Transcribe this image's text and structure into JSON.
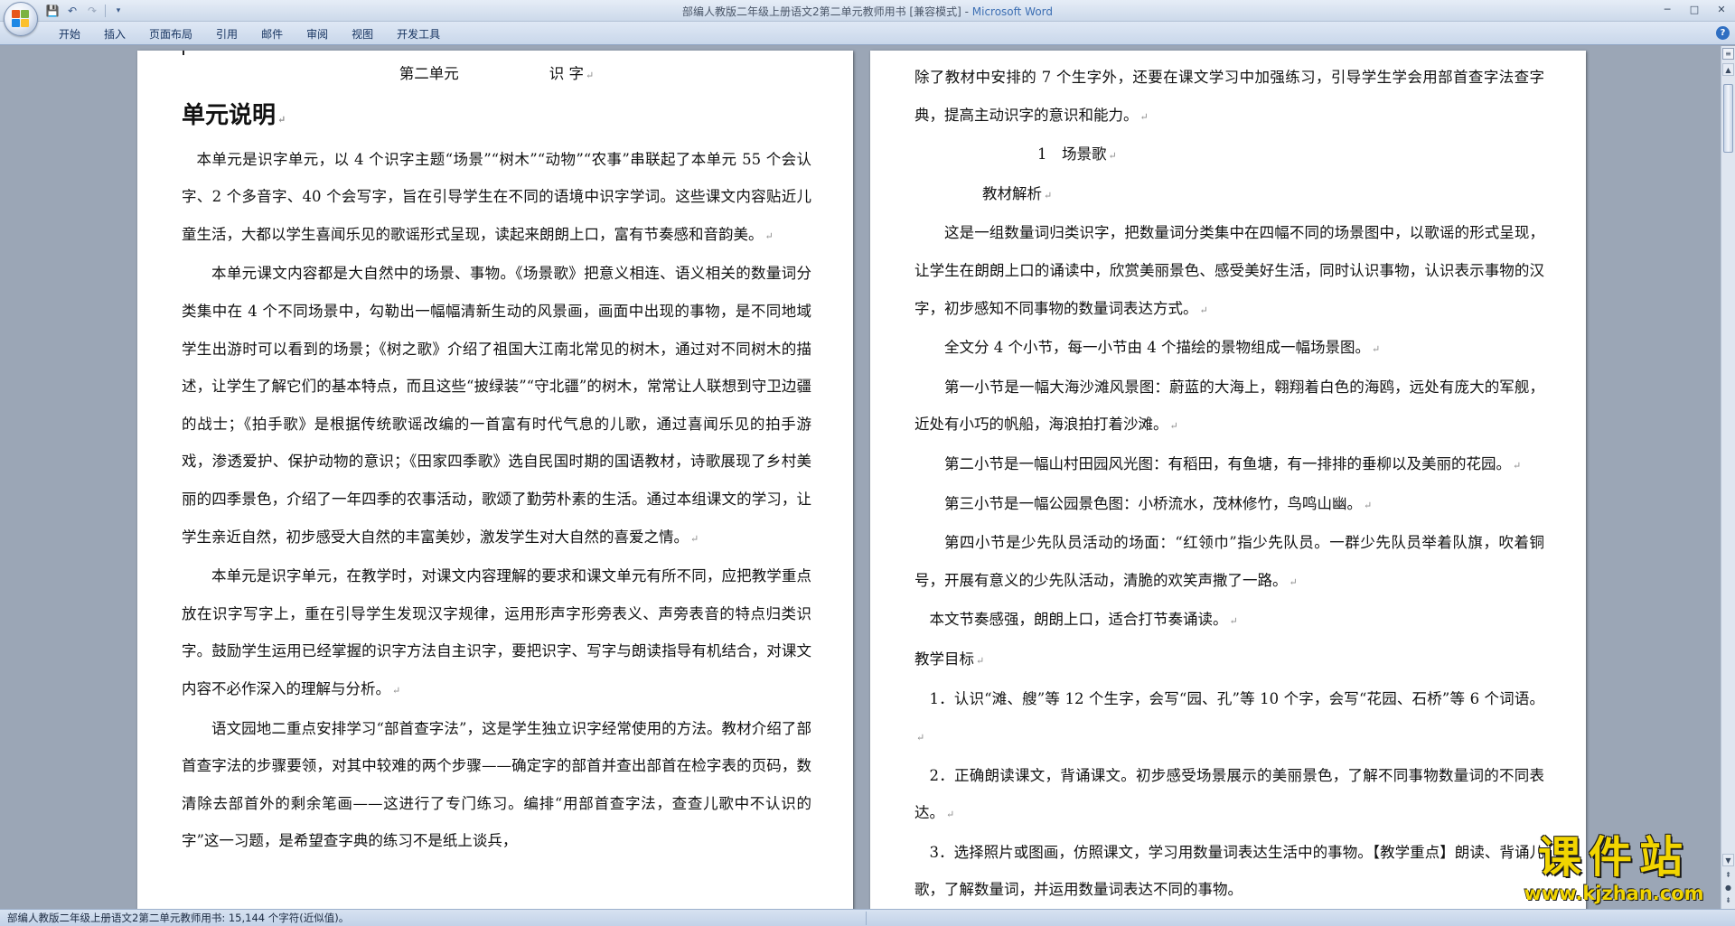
{
  "window": {
    "doc_name": "部编人教版二年级上册语文2第二单元教师用书 [兼容模式]",
    "separator": " - ",
    "app_name": "Microsoft Word",
    "minimize": "─",
    "maximize": "□",
    "close": "✕"
  },
  "quick_access": {
    "save_icon": "floppy-disk-icon",
    "undo_icon": "undo-icon",
    "redo_icon": "redo-icon",
    "customize_icon": "dropdown-icon"
  },
  "ribbon": {
    "tabs": [
      "开始",
      "插入",
      "页面布局",
      "引用",
      "邮件",
      "审阅",
      "视图",
      "开发工具"
    ],
    "help": "?"
  },
  "left_page": {
    "title_unit": "第二单元",
    "title_topic": "识 字",
    "heading": "单元说明",
    "paragraphs": [
      "本单元是识字单元，以 4 个识字主题“场景”“树木”“动物”“农事”串联起了本单元 55 个会认字、2 个多音字、40 个会写字，旨在引导学生在不同的语境中识字学词。这些课文内容贴近儿童生活，大都以学生喜闻乐见的歌谣形式呈现，读起来朗朗上口，富有节奏感和音韵美。",
      "本单元课文内容都是大自然中的场景、事物。《场景歌》把意义相连、语义相关的数量词分类集中在 4 个不同场景中，勾勒出一幅幅清新生动的风景画，画面中出现的事物，是不同地域学生出游时可以看到的场景；《树之歌》介绍了祖国大江南北常见的树木，通过对不同树木的描述，让学生了解它们的基本特点，而且这些“披绿装”“守北疆”的树木，常常让人联想到守卫边疆的战士；《拍手歌》是根据传统歌谣改编的一首富有时代气息的儿歌，通过喜闻乐见的拍手游戏，渗透爱护、保护动物的意识；《田家四季歌》选自民国时期的国语教材，诗歌展现了乡村美丽的四季景色，介绍了一年四季的农事活动，歌颂了勤劳朴素的生活。通过本组课文的学习，让学生亲近自然，初步感受大自然的丰富美妙，激发学生对大自然的喜爱之情。",
      "本单元是识字单元，在教学时，对课文内容理解的要求和课文单元有所不同，应把教学重点放在识字写字上，重在引导学生发现汉字规律，运用形声字形旁表义、声旁表音的特点归类识字。鼓励学生运用已经掌握的识字方法自主识字，要把识字、写字与朗读指导有机结合，对课文内容不必作深入的理解与分析。",
      "语文园地二重点安排学习“部首查字法”，这是学生独立识字经常使用的方法。教材介绍了部首查字法的步骤要领，对其中较难的两个步骤——确定字的部首并查出部首在检字表的页码，数清除去部首外的剩余笔画——这进行了专门练习。编排“用部首查字法，查查儿歌中不认识的字”这一习题，是希望查字典的练习不是纸上谈兵，"
    ]
  },
  "right_page": {
    "paragraph_cont": "除了教材中安排的 7 个生字外，还要在课文学习中加强练习，引导学生学会用部首查字法查字典，提高主动识字的意识和能力。",
    "lesson_title": "1　场景歌",
    "analysis_heading": "教材解析",
    "paragraphs": [
      "这是一组数量词归类识字，把数量词分类集中在四幅不同的场景图中，以歌谣的形式呈现，让学生在朗朗上口的诵读中，欣赏美丽景色、感受美好生活，同时认识事物，认识表示事物的汉字，初步感知不同事物的数量词表达方式。",
      "全文分 4 个小节，每一小节由 4 个描绘的景物组成一幅场景图。",
      "第一小节是一幅大海沙滩风景图：蔚蓝的大海上，翱翔着白色的海鸥，远处有庞大的军舰，近处有小巧的帆船，海浪拍打着沙滩。",
      "第二小节是一幅山村田园风光图：有稻田，有鱼塘，有一排排的垂柳以及美丽的花园。",
      "第三小节是一幅公园景色图：小桥流水，茂林修竹，鸟鸣山幽。",
      "第四小节是少先队员活动的场面：“红领巾”指少先队员。一群少先队员举着队旗，吹着铜号，开展有意义的少先队活动，清脆的欢笑声撒了一路。"
    ],
    "rhythm": "本文节奏感强，朗朗上口，适合打节奏诵读。",
    "goals_heading": "教学目标",
    "goals": [
      "1．认识“滩、艘”等 12 个生字，会写“园、孔”等 10 个字，会写“花园、石桥”等 6 个词语。",
      "2．正确朗读课文，背诵课文。初步感受场景展示的美丽景色，了解不同事物数量词的不同表达。",
      "3．选择照片或图画，仿照课文，学习用数量词表达生活中的事物。【教学重点】朗读、背诵儿歌，了解数量词，并运用数量词表达不同的事物。"
    ]
  },
  "paragraph_mark": "↵",
  "statusbar": {
    "text": "部编人教版二年级上册语文2第二单元教师用书: 15,144 个字符(近似值)。"
  },
  "watermark": {
    "main": "课件站",
    "url": "www.kjzhan.com"
  }
}
